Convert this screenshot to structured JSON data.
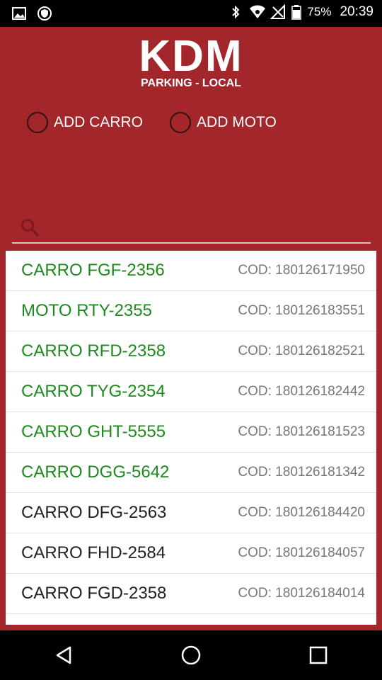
{
  "status_bar": {
    "battery": "75%",
    "time": "20:39"
  },
  "logo": {
    "title": "KDM",
    "subtitle": "PARKING - LOCAL"
  },
  "radios": {
    "car_label": "ADD CARRO",
    "moto_label": "ADD MOTO"
  },
  "search": {
    "placeholder": "",
    "value": ""
  },
  "list": [
    {
      "plate": "CARRO FGF-2356",
      "code": "COD: 180126171950",
      "color": "#1e8a1e"
    },
    {
      "plate": "MOTO RTY-2355",
      "code": "COD: 180126183551",
      "color": "#1e8a1e"
    },
    {
      "plate": "CARRO RFD-2358",
      "code": "COD: 180126182521",
      "color": "#1e8a1e"
    },
    {
      "plate": "CARRO TYG-2354",
      "code": "COD: 180126182442",
      "color": "#1e8a1e"
    },
    {
      "plate": "CARRO GHT-5555",
      "code": "COD: 180126181523",
      "color": "#1e8a1e"
    },
    {
      "plate": "CARRO DGG-5642",
      "code": "COD: 180126181342",
      "color": "#1e8a1e"
    },
    {
      "plate": "CARRO DFG-2563",
      "code": "COD: 180126184420",
      "color": "#222222"
    },
    {
      "plate": "CARRO FHD-2584",
      "code": "COD: 180126184057",
      "color": "#222222"
    },
    {
      "plate": "CARRO FGD-2358",
      "code": "COD: 180126184014",
      "color": "#222222"
    }
  ],
  "colors": {
    "brand": "#a3262a",
    "active_plate": "#1e8a1e",
    "inactive_plate": "#222222"
  },
  "icons": {
    "status_left": [
      "image-icon",
      "shield-icon"
    ],
    "status_right": [
      "bluetooth-icon",
      "wifi-icon",
      "no-signal-icon",
      "battery-icon"
    ],
    "search": "search-icon",
    "nav": [
      "back-icon",
      "home-icon",
      "recents-icon"
    ]
  }
}
